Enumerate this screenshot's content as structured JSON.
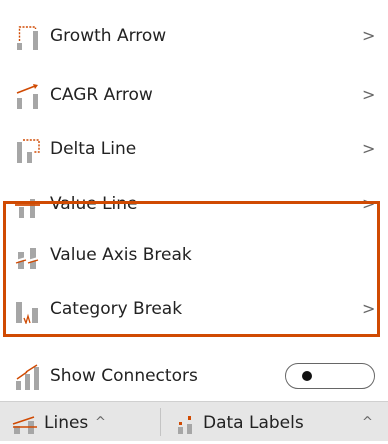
{
  "menu": {
    "items": [
      {
        "label": "Growth Arrow",
        "icon": "growth-arrow-icon",
        "has_submenu": true,
        "chevron": ">"
      },
      {
        "label": "CAGR Arrow",
        "icon": "cagr-arrow-icon",
        "has_submenu": true,
        "chevron": ">"
      },
      {
        "label": "Delta Line",
        "icon": "delta-line-icon",
        "has_submenu": true,
        "chevron": ">"
      },
      {
        "label": "Value Line",
        "icon": "value-line-icon",
        "has_submenu": true,
        "chevron": ">"
      },
      {
        "label": "Value Axis Break",
        "icon": "value-axis-break-icon",
        "has_submenu": false,
        "chevron": ""
      },
      {
        "label": "Category Break",
        "icon": "category-break-icon",
        "has_submenu": true,
        "chevron": ">"
      }
    ],
    "show_connectors": {
      "label": "Show Connectors",
      "icon": "connectors-icon",
      "toggle_on": false
    }
  },
  "bottom_bar": {
    "tabs": [
      {
        "label": "Lines",
        "caret": "^",
        "icon": "lines-icon"
      },
      {
        "label": "Data Labels",
        "caret": "^",
        "icon": "data-labels-icon"
      }
    ]
  },
  "colors": {
    "accent": "#D04A02",
    "icon_grey": "#A6A6A6",
    "bar_background": "#E6E6E6"
  }
}
